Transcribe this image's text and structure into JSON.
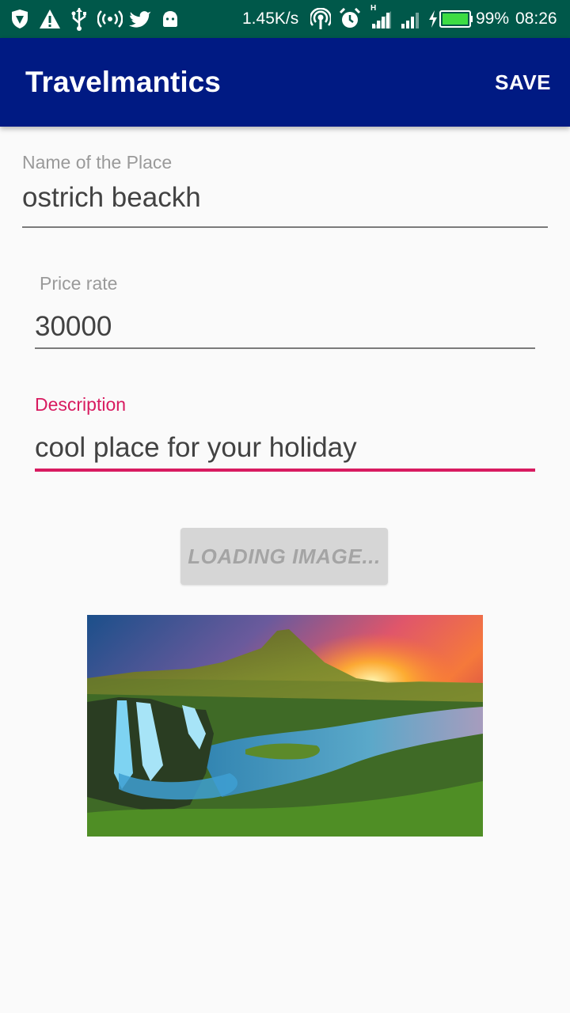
{
  "status_bar": {
    "icons": [
      "shield-icon",
      "warning-icon",
      "usb-icon",
      "hotspot-icon",
      "twitter-icon",
      "android-icon",
      "wifi-icon",
      "alarm-icon",
      "signal-h-icon",
      "signal-icon",
      "battery-charging-icon"
    ],
    "network_speed": "1.45K/s",
    "network_type": "H",
    "battery_percent": "99%",
    "time": "08:26",
    "background_color": "#00584a"
  },
  "app_bar": {
    "title": "Travelmantics",
    "save_label": "SAVE",
    "background_color": "#001a83"
  },
  "form": {
    "name": {
      "label": "Name of the Place",
      "value": "ostrich beackh"
    },
    "price": {
      "label": "Price rate",
      "value": "30000"
    },
    "description": {
      "label": "Description",
      "value": "cool place for your holiday",
      "focused": true
    },
    "accent_color": "#d81b60"
  },
  "load_button": {
    "label": "LOADING IMAGE...",
    "enabled": false
  },
  "image": {
    "description": "landscape photo: waterfall, river, green hills and mountain at sunset"
  }
}
